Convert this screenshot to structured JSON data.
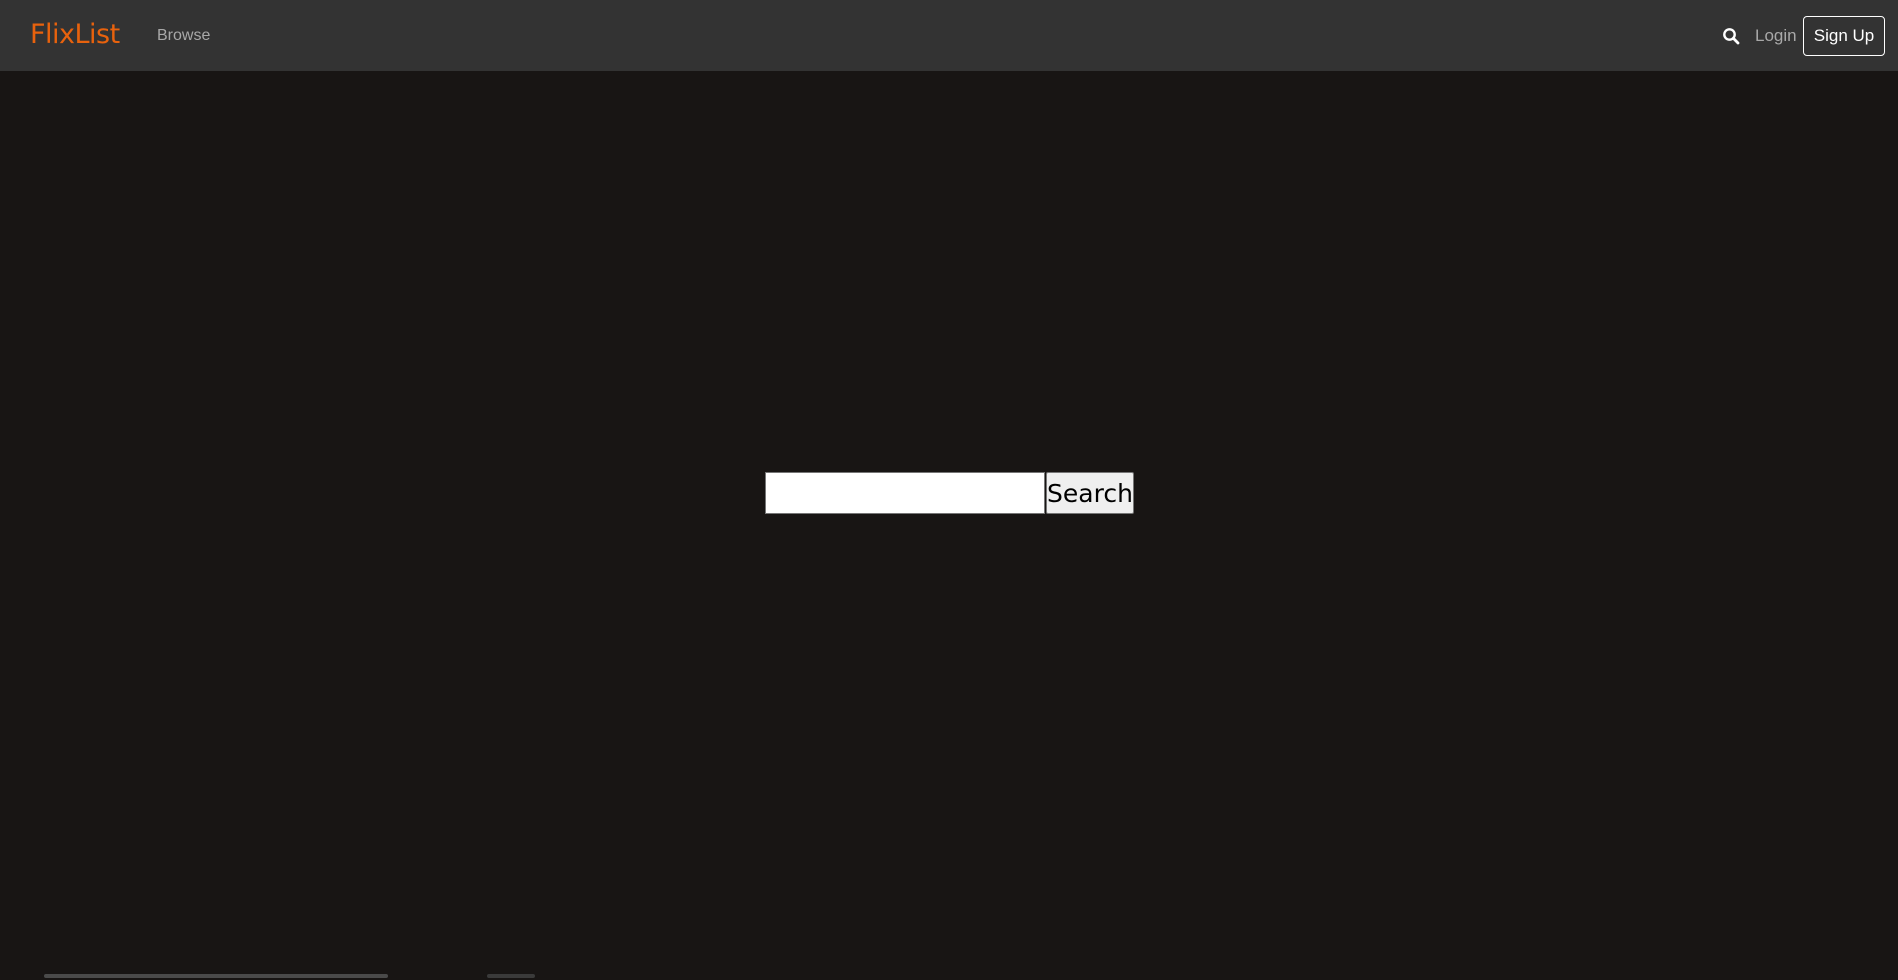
{
  "navbar": {
    "logo": "FlixList",
    "browse_label": "Browse",
    "search_icon": "search-icon",
    "login_label": "Login",
    "signup_label": "Sign Up"
  },
  "search": {
    "value": "",
    "placeholder": "",
    "button_label": "Search"
  },
  "colors": {
    "brand": "#e8620d",
    "navbar_bg": "#333333",
    "page_bg": "#181514"
  }
}
